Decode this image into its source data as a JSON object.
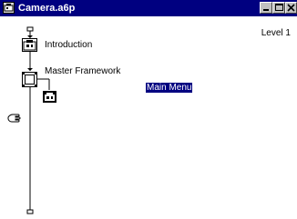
{
  "window": {
    "title": "Camera.a6p"
  },
  "level_label": "Level 1",
  "flow": {
    "items": [
      {
        "label": "Introduction",
        "icon": "map-icon"
      },
      {
        "label": "Master Framework",
        "icon": "framework-icon"
      }
    ],
    "selected_label": "Main Menu"
  },
  "icons": {
    "title": "authorware-file-icon",
    "pointer": "paste-hand-icon"
  }
}
